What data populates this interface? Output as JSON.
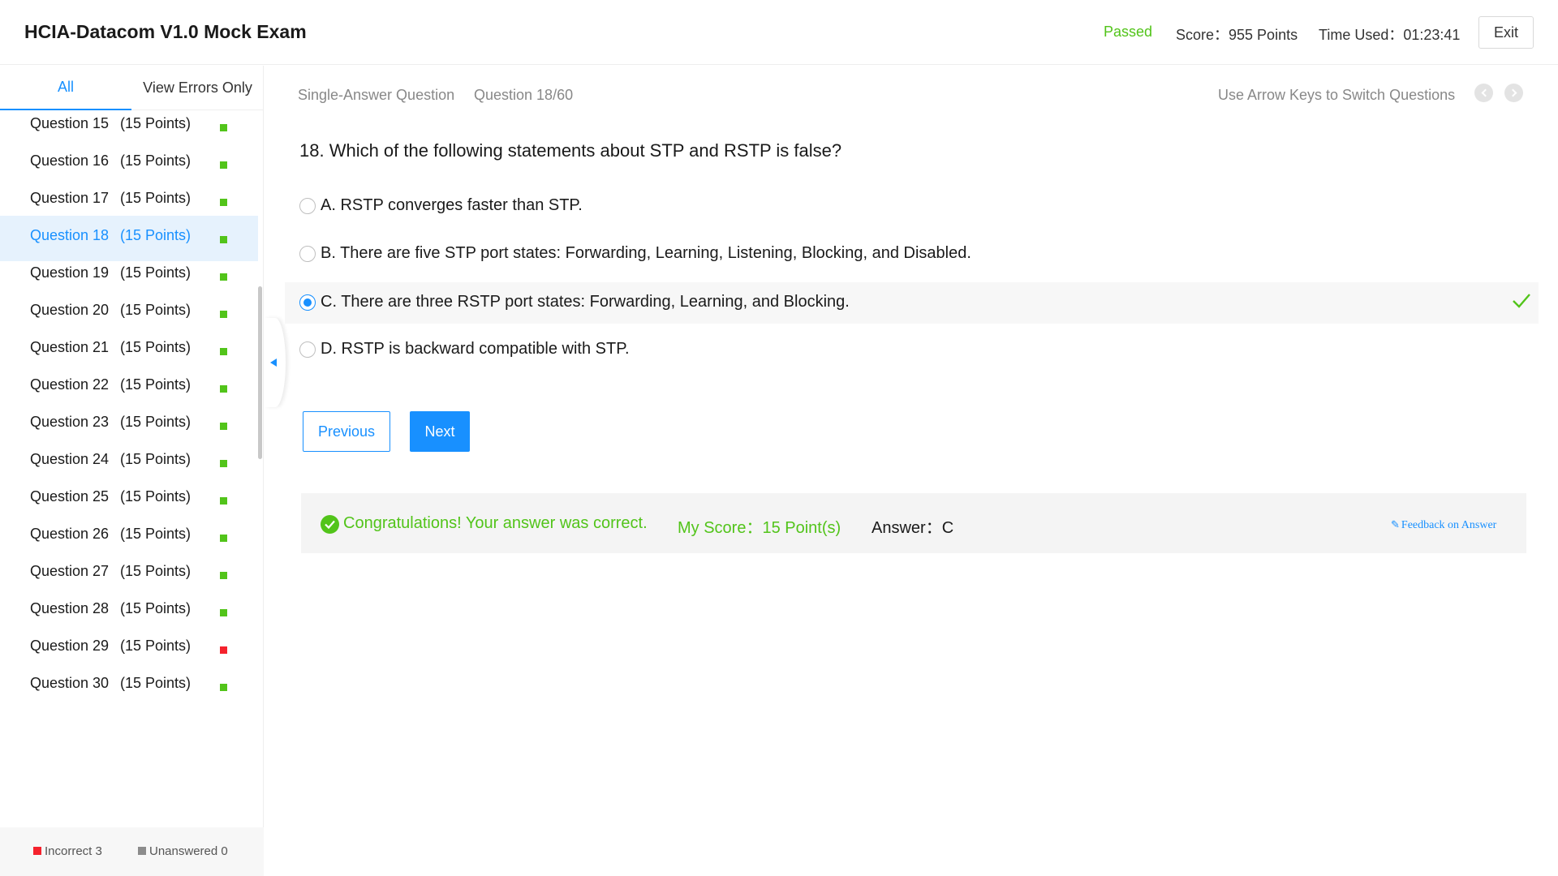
{
  "header": {
    "title": "HCIA-Datacom V1.0 Mock Exam",
    "status": "Passed",
    "score": "Score：955 Points",
    "time_used": "Time Used：01:23:41",
    "exit_label": "Exit"
  },
  "sidebar": {
    "tabs": {
      "all": "All",
      "errors_only": "View Errors Only"
    },
    "questions": [
      {
        "label": "Question 15",
        "points": "(15 Points)",
        "status": "correct"
      },
      {
        "label": "Question 16",
        "points": "(15 Points)",
        "status": "correct"
      },
      {
        "label": "Question 17",
        "points": "(15 Points)",
        "status": "correct"
      },
      {
        "label": "Question 18",
        "points": "(15 Points)",
        "status": "correct",
        "active": true
      },
      {
        "label": "Question 19",
        "points": "(15 Points)",
        "status": "correct"
      },
      {
        "label": "Question 20",
        "points": "(15 Points)",
        "status": "correct"
      },
      {
        "label": "Question 21",
        "points": "(15 Points)",
        "status": "correct"
      },
      {
        "label": "Question 22",
        "points": "(15 Points)",
        "status": "correct"
      },
      {
        "label": "Question 23",
        "points": "(15 Points)",
        "status": "correct"
      },
      {
        "label": "Question 24",
        "points": "(15 Points)",
        "status": "correct"
      },
      {
        "label": "Question 25",
        "points": "(15 Points)",
        "status": "correct"
      },
      {
        "label": "Question 26",
        "points": "(15 Points)",
        "status": "correct"
      },
      {
        "label": "Question 27",
        "points": "(15 Points)",
        "status": "correct"
      },
      {
        "label": "Question 28",
        "points": "(15 Points)",
        "status": "correct"
      },
      {
        "label": "Question 29",
        "points": "(15 Points)",
        "status": "incorrect"
      },
      {
        "label": "Question 30",
        "points": "(15 Points)",
        "status": "correct"
      }
    ],
    "legend": {
      "incorrect": "Incorrect 3",
      "unanswered": "Unanswered 0"
    }
  },
  "main": {
    "question_type": "Single-Answer Question",
    "question_progress": "Question 18/60",
    "hint": "Use Arrow Keys to Switch Questions",
    "question_text": "18. Which of the following statements about STP and RSTP is false?",
    "options": [
      {
        "text": "A. RSTP converges faster than STP.",
        "selected": false
      },
      {
        "text": "B. There are five STP port states: Forwarding, Learning, Listening, Blocking, and Disabled.",
        "selected": false
      },
      {
        "text": "C. There are three RSTP port states: Forwarding, Learning, and Blocking.",
        "selected": true,
        "correct_mark": true
      },
      {
        "text": "D. RSTP is backward compatible with STP.",
        "selected": false
      }
    ],
    "prev_label": "Previous",
    "next_label": "Next",
    "result": {
      "message": "Congratulations! Your answer was correct.",
      "my_score": "My Score：15 Point(s)",
      "answer": "Answer：C",
      "feedback_label": "Feedback on Answer"
    }
  },
  "colors": {
    "accent": "#1890ff",
    "correct": "#52c41a",
    "incorrect": "#f5222d",
    "unanswered": "#8c8c8c"
  }
}
